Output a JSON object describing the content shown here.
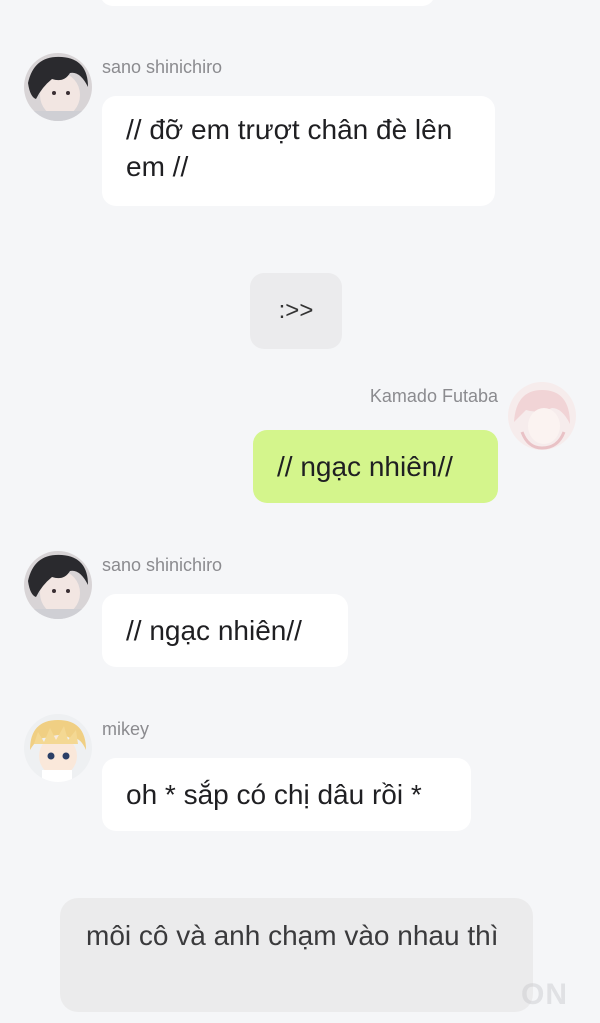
{
  "messages": [
    {
      "type": "incoming",
      "sender": "sano shinichiro",
      "text": "// đỡ em trượt chân đè lên em //",
      "avatar": "avatar-dark-hair-boy"
    },
    {
      "type": "system",
      "text": ":>>"
    },
    {
      "type": "outgoing",
      "sender": "Kamado Futaba",
      "text": "// ngạc nhiên//",
      "avatar": "avatar-pink-girl"
    },
    {
      "type": "incoming",
      "sender": "sano shinichiro",
      "text": "// ngạc nhiên//",
      "avatar": "avatar-dark-hair-boy"
    },
    {
      "type": "incoming",
      "sender": "mikey",
      "text": "oh * sắp có chị dâu rồi *",
      "avatar": "avatar-blond-boy"
    }
  ],
  "narration": "môi cô và anh chạm vào nhau thì",
  "watermark": "ON",
  "colors": {
    "background": "#f5f6f8",
    "incoming_bubble": "#ffffff",
    "outgoing_bubble": "#d4f58c",
    "system_bubble": "#ebebed",
    "name_text": "#8b8b8f"
  }
}
